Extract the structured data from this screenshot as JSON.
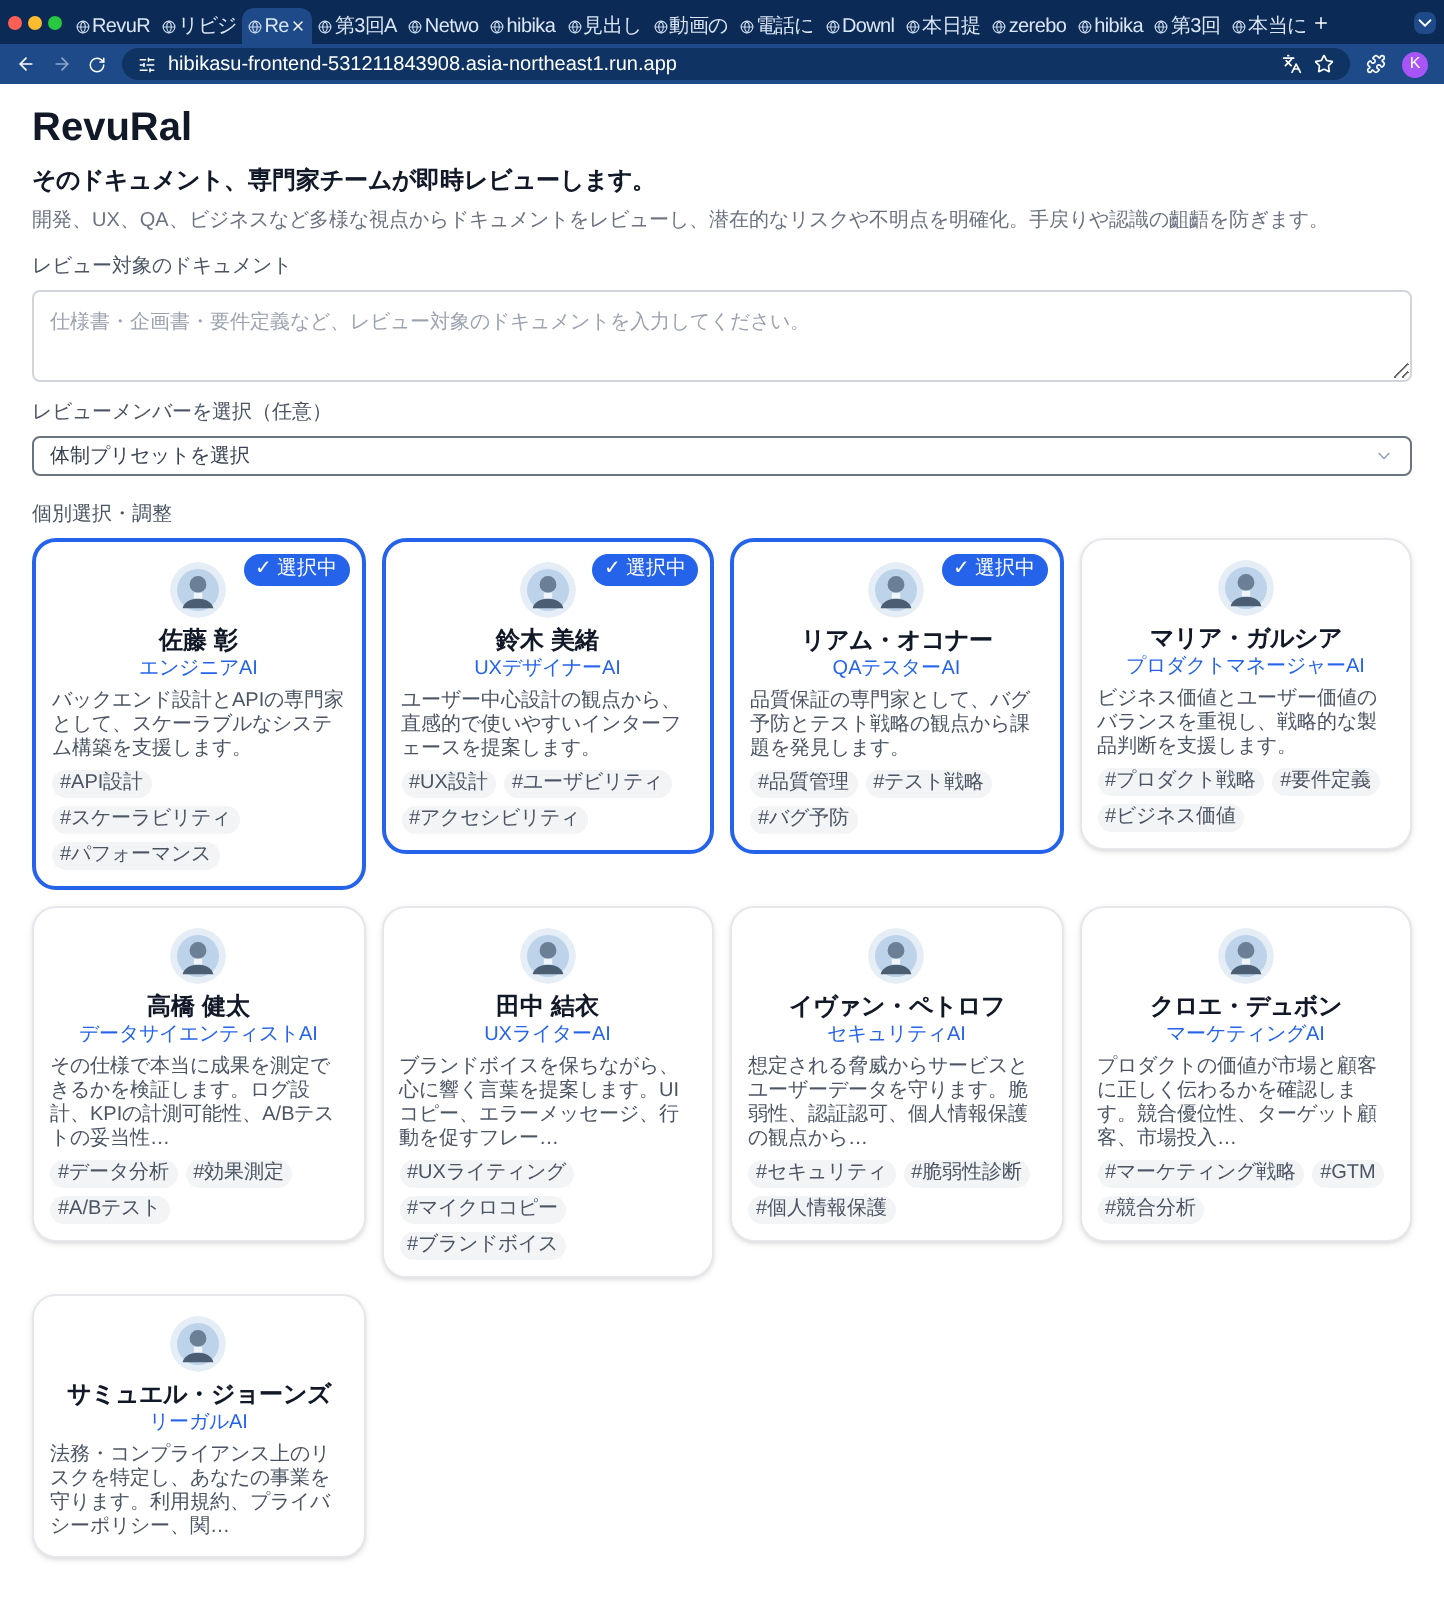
{
  "browser": {
    "tabs": [
      {
        "title": "RevuR",
        "selected": false
      },
      {
        "title": "リビジ",
        "selected": false
      },
      {
        "title": "Re",
        "selected": true
      },
      {
        "title": "第3回A",
        "selected": false
      },
      {
        "title": "Netwo",
        "selected": false
      },
      {
        "title": "hibika",
        "selected": false
      },
      {
        "title": "見出し",
        "selected": false
      },
      {
        "title": "動画の",
        "selected": false
      },
      {
        "title": "電話に",
        "selected": false
      },
      {
        "title": "Downl",
        "selected": false
      },
      {
        "title": "本日提",
        "selected": false
      },
      {
        "title": "zerebo",
        "selected": false
      },
      {
        "title": "hibika",
        "selected": false
      },
      {
        "title": "第3回",
        "selected": false
      },
      {
        "title": "本当に",
        "selected": false
      }
    ],
    "url": "hibikasu-frontend-531211843908.asia-northeast1.run.app",
    "profile": "K"
  },
  "page": {
    "title": "RevuRal",
    "subtitle": "そのドキュメント、専門家チームが即時レビューします。",
    "description": "開発、UX、QA、ビジネスなど多様な視点からドキュメントをレビューし、潜在的なリスクや不明点を明確化。手戻りや認識の齟齬を防ぎます。",
    "document_label": "レビュー対象のドキュメント",
    "document_placeholder": "仕様書・企画書・要件定義など、レビュー対象のドキュメントを入力してください。",
    "preset_label": "レビューメンバーを選択（任意）",
    "preset_value": "体制プリセットを選択",
    "members_label": "個別選択・調整",
    "members": [
      {
        "name": "佐藤 彰",
        "role": "エンジニアAI",
        "description": "バックエンド設計とAPIの専門家として、スケーラブルなシステム構築を支援します。",
        "tags": [
          "#API設計",
          "#スケーラビリティ",
          "#パフォーマンス"
        ],
        "selected": true,
        "badge": "✓ 選択中"
      },
      {
        "name": "鈴木 美緒",
        "role": "UXデザイナーAI",
        "description": "ユーザー中心設計の観点から、直感的で使いやすいインターフェースを提案します。",
        "tags": [
          "#UX設計",
          "#ユーザビリティ",
          "#アクセシビリティ"
        ],
        "selected": true,
        "badge": "✓ 選択中"
      },
      {
        "name": "リアム・オコナー",
        "role": "QAテスターAI",
        "description": "品質保証の専門家として、バグ予防とテスト戦略の観点から課題を発見します。",
        "tags": [
          "#品質管理",
          "#テスト戦略",
          "#バグ予防"
        ],
        "selected": true,
        "badge": "✓ 選択中"
      },
      {
        "name": "マリア・ガルシア",
        "role": "プロダクトマネージャーAI",
        "description": "ビジネス価値とユーザー価値のバランスを重視し、戦略的な製品判断を支援します。",
        "tags": [
          "#プロダクト戦略",
          "#要件定義",
          "#ビジネス価値"
        ],
        "selected": false
      },
      {
        "name": "高橋 健太",
        "role": "データサイエンティストAI",
        "description": "その仕様で本当に成果を測定できるかを検証します。ログ設計、KPIの計測可能性、A/Bテストの妥当性…",
        "tags": [
          "#データ分析",
          "#効果測定",
          "#A/Bテスト"
        ],
        "selected": false
      },
      {
        "name": "田中 結衣",
        "role": "UXライターAI",
        "description": "ブランドボイスを保ちながら、心に響く言葉を提案します。UIコピー、エラーメッセージ、行動を促すフレー…",
        "tags": [
          "#UXライティング",
          "#マイクロコピー",
          "#ブランドボイス"
        ],
        "selected": false
      },
      {
        "name": "イヴァン・ペトロフ",
        "role": "セキュリティAI",
        "description": "想定される脅威からサービスとユーザーデータを守ります。脆弱性、認証認可、個人情報保護の観点から…",
        "tags": [
          "#セキュリティ",
          "#脆弱性診断",
          "#個人情報保護"
        ],
        "selected": false
      },
      {
        "name": "クロエ・デュボン",
        "role": "マーケティングAI",
        "description": "プロダクトの価値が市場と顧客に正しく伝わるかを確認します。競合優位性、ターゲット顧客、市場投入…",
        "tags": [
          "#マーケティング戦略",
          "#GTM",
          "#競合分析"
        ],
        "selected": false
      },
      {
        "name": "サミュエル・ジョーンズ",
        "role": "リーガルAI",
        "description": "法務・コンプライアンス上のリスクを特定し、あなたの事業を守ります。利用規約、プライバシーポリシー、関…",
        "selected": false
      }
    ]
  }
}
